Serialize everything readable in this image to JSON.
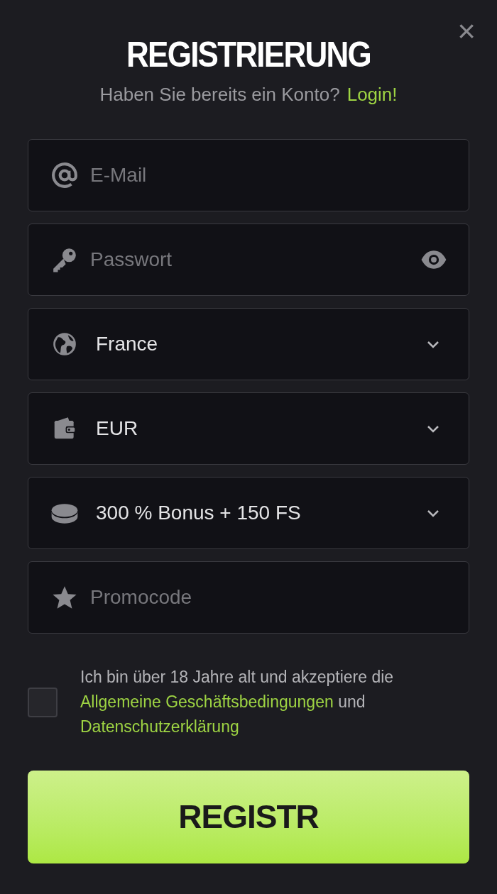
{
  "title": "REGISTRIERUNG",
  "subtitle": {
    "text": "Haben Sie bereits ein Konto?",
    "link": "Login!"
  },
  "close": "×",
  "fields": [
    {
      "kind": "text",
      "placeholder": "E-Mail"
    },
    {
      "kind": "password",
      "placeholder": "Passwort"
    },
    {
      "kind": "select",
      "value": "France"
    },
    {
      "kind": "select",
      "value": "EUR"
    },
    {
      "kind": "select",
      "value": "300 % Bonus + 150 FS"
    },
    {
      "kind": "text",
      "placeholder": "Promocode"
    }
  ],
  "consent": {
    "checked": false,
    "parts": [
      {
        "kind": "text",
        "text": "Ich bin über 18 Jahre alt und akzeptiere die"
      },
      {
        "kind": "link",
        "text": "Allgemeine Geschäftsbedingungen"
      },
      {
        "kind": "text",
        "text": "und"
      },
      {
        "kind": "link",
        "text": "Datenschutzerklärung"
      }
    ]
  },
  "submit": "REGISTR"
}
